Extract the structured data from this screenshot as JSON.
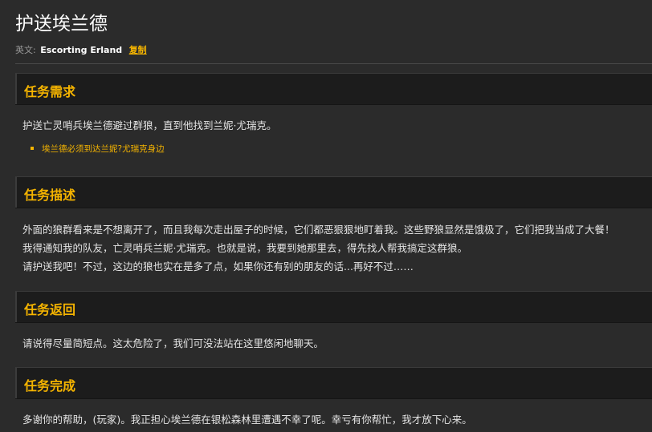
{
  "page": {
    "title": "护送埃兰德",
    "english_label": "英文:",
    "english_name": "Escorting Erland",
    "copy_label": "复制"
  },
  "sections": {
    "requirements": {
      "title": "任务需求",
      "text": "护送亡灵哨兵埃兰德避过群狼，直到他找到兰妮·尤瑞克。",
      "objective": "埃兰德必须到达兰妮?尤瑞克身边"
    },
    "description": {
      "title": "任务描述",
      "lines": [
        "外面的狼群看来是不想离开了，而且我每次走出屋子的时候，它们都恶狠狠地盯着我。这些野狼显然是饿极了，它们把我当成了大餐！",
        "我得通知我的队友，亡灵哨兵兰妮·尤瑞克。也就是说，我要到她那里去，得先找人帮我搞定这群狼。",
        "请护送我吧！不过，这边的狼也实在是多了点，如果你还有别的朋友的话...再好不过……"
      ]
    },
    "progress": {
      "title": "任务返回",
      "text": "请说得尽量简短点。这太危险了，我们可没法站在这里悠闲地聊天。"
    },
    "completion": {
      "title": "任务完成",
      "text": "多谢你的帮助，(玩家)。我正担心埃兰德在银松森林里遭遇不幸了呢。幸亏有你帮忙，我才放下心来。"
    }
  },
  "colors": {
    "background": "#2b2b2b",
    "header_bg": "#1c1c1c",
    "accent": "#f5b400",
    "text": "#e4e4e4"
  }
}
